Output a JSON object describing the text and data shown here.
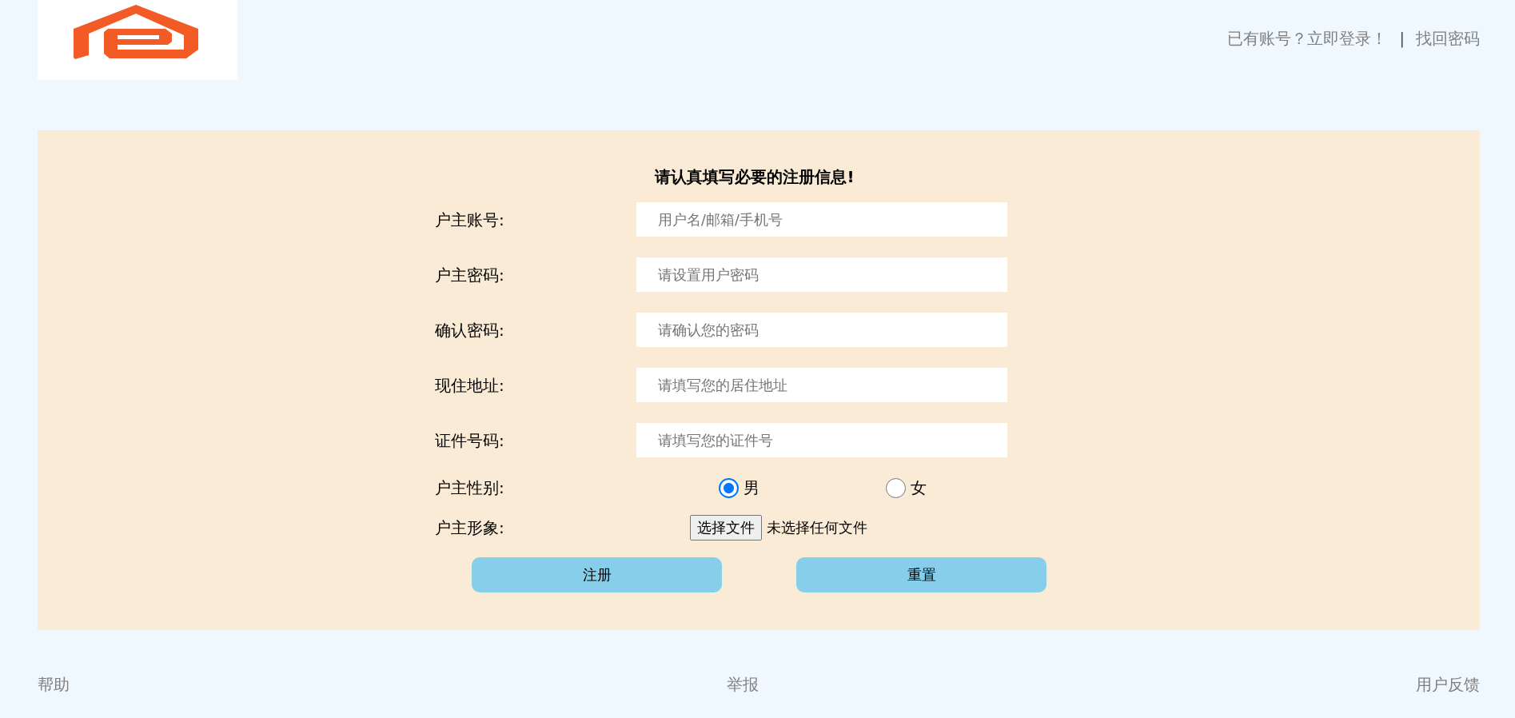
{
  "header": {
    "links": [
      "已有账号？立即登录！",
      "找回密码"
    ],
    "separator": "|"
  },
  "form": {
    "title": "请认真填写必要的注册信息!",
    "fields": [
      {
        "label": "户主账号:",
        "placeholder": "用户名/邮箱/手机号"
      },
      {
        "label": "户主密码:",
        "placeholder": "请设置用户密码"
      },
      {
        "label": "确认密码:",
        "placeholder": "请确认您的密码"
      },
      {
        "label": "现住地址:",
        "placeholder": "请填写您的居住地址"
      },
      {
        "label": "证件号码:",
        "placeholder": "请填写您的证件号"
      }
    ],
    "gender": {
      "label": "户主性别:",
      "options": [
        {
          "label": "男",
          "selected": true
        },
        {
          "label": "女",
          "selected": false
        }
      ]
    },
    "avatar": {
      "label": "户主形象:",
      "button": "选择文件",
      "status": "未选择任何文件"
    },
    "buttons": [
      "注册",
      "重置"
    ]
  },
  "footer": {
    "links": [
      "帮助",
      "举报",
      "用户反馈"
    ]
  }
}
